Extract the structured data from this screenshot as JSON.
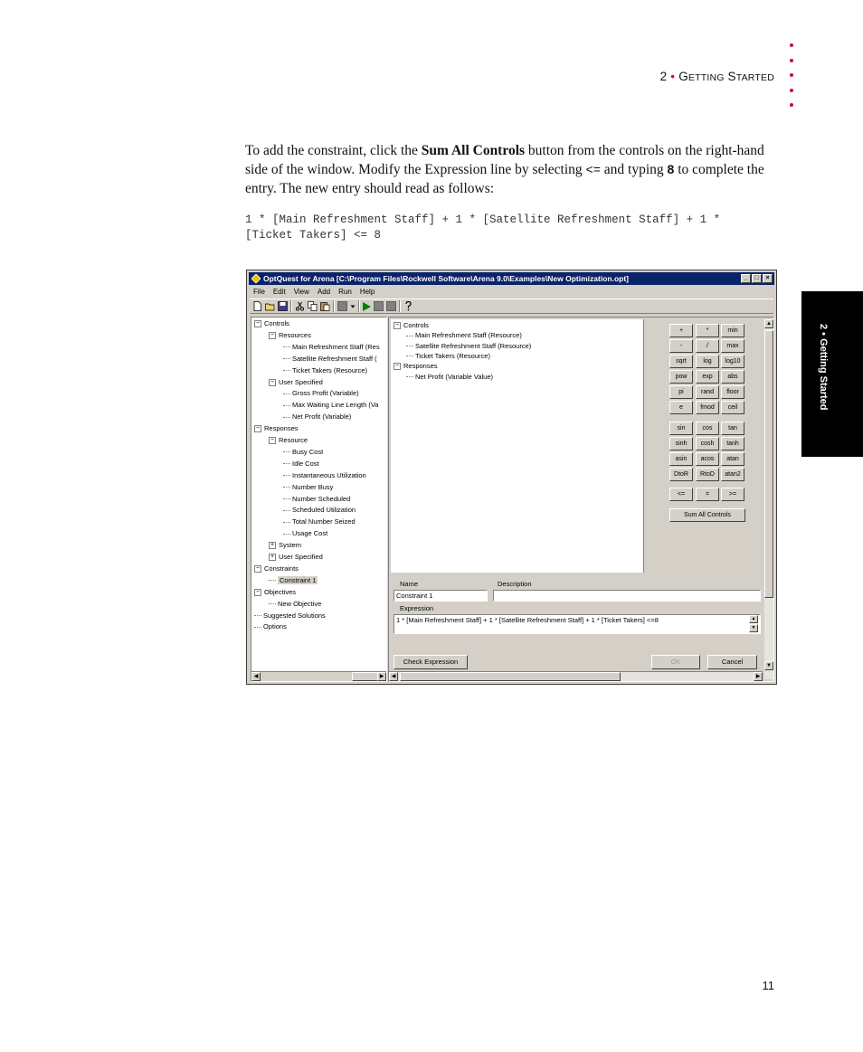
{
  "running_head": {
    "chapter": "2",
    "bullet": "•",
    "title_g": "G",
    "title_rest1": "ETTING",
    "title_s": "S",
    "title_rest2": "TARTED"
  },
  "side_tab": "2 • Getting Started",
  "paragraph": {
    "p1": "To add the constraint, click the ",
    "b1": "Sum All Controls",
    "p2": " button from the controls on the right-hand side of the window. Modify the Expression line by selecting ",
    "s1": "<=",
    "p3": " and typing ",
    "s2": "8",
    "p4": " to complete the entry. The new entry should read as follows:"
  },
  "code_lines": [
    "1 * [Main Refreshment Staff] + 1 * [Satellite Refreshment Staff] + 1 *",
    "[Ticket Takers] <= 8"
  ],
  "window": {
    "title": "OptQuest for Arena  [C:\\Program Files\\Rockwell Software\\Arena 9.0\\Examples\\New Optimization.opt]",
    "menu": [
      "File",
      "Edit",
      "View",
      "Add",
      "Run",
      "Help"
    ],
    "tree": [
      {
        "label": "Controls",
        "indent": 0,
        "pm": "−"
      },
      {
        "label": "Resources",
        "indent": 1,
        "pm": "−"
      },
      {
        "label": "Main Refreshment Staff (Res",
        "indent": 2
      },
      {
        "label": "Satellite Refreshment Staff (",
        "indent": 2
      },
      {
        "label": "Ticket Takers (Resource)",
        "indent": 2
      },
      {
        "label": "User Specified",
        "indent": 1,
        "pm": "−"
      },
      {
        "label": "Gross Profit (Variable)",
        "indent": 2
      },
      {
        "label": "Max Waiting Line Length (Va",
        "indent": 2
      },
      {
        "label": "Net Profit (Variable)",
        "indent": 2
      },
      {
        "label": "Responses",
        "indent": 0,
        "pm": "−"
      },
      {
        "label": "Resource",
        "indent": 1,
        "pm": "−"
      },
      {
        "label": "Busy Cost",
        "indent": 2
      },
      {
        "label": "Idle Cost",
        "indent": 2
      },
      {
        "label": "Instantaneous Utilization",
        "indent": 2
      },
      {
        "label": "Number Busy",
        "indent": 2
      },
      {
        "label": "Number Scheduled",
        "indent": 2
      },
      {
        "label": "Scheduled Utilization",
        "indent": 2
      },
      {
        "label": "Total Number Seized",
        "indent": 2
      },
      {
        "label": "Usage Cost",
        "indent": 2
      },
      {
        "label": "System",
        "indent": 1,
        "pm": "+"
      },
      {
        "label": "User Specified",
        "indent": 1,
        "pm": "+"
      },
      {
        "label": "Constraints",
        "indent": 0,
        "pm": "−"
      },
      {
        "label": "Constraint 1",
        "indent": 1,
        "selected": true
      },
      {
        "label": "Objectives",
        "indent": 0,
        "pm": "−"
      },
      {
        "label": "New Objective",
        "indent": 1
      },
      {
        "label": "Suggested Solutions",
        "indent": 0
      },
      {
        "label": "Options",
        "indent": 0
      }
    ],
    "controls_tree": [
      {
        "label": "Controls",
        "indent": 0,
        "pm": "−"
      },
      {
        "label": "Main Refreshment Staff (Resource)",
        "indent": 1
      },
      {
        "label": "Satellite Refreshment Staff (Resource)",
        "indent": 1
      },
      {
        "label": "Ticket Takers (Resource)",
        "indent": 1
      },
      {
        "label": "Responses",
        "indent": 0,
        "pm": "−"
      },
      {
        "label": "Net Profit (Variable Value)",
        "indent": 1
      }
    ],
    "calc_rows": [
      [
        "+",
        "*",
        "min"
      ],
      [
        "-",
        "/",
        "max"
      ],
      [
        "sqrt",
        "log",
        "log10"
      ],
      [
        "pow",
        "exp",
        "abs"
      ],
      [
        "pi",
        "rand",
        "floor"
      ],
      [
        "e",
        "fmod",
        "ceil"
      ],
      [],
      [
        "sin",
        "cos",
        "tan"
      ],
      [
        "sinh",
        "cosh",
        "tanh"
      ],
      [
        "asin",
        "acos",
        "atan"
      ],
      [
        "DtoR",
        "RtoD",
        "atan2"
      ]
    ],
    "compare_buttons": [
      "<=",
      "=",
      ">="
    ],
    "sum_button": "Sum All Controls",
    "name_label": "Name",
    "description_label": "Description",
    "name_value": "Constraint 1",
    "description_value": "",
    "expression_label": "Expression",
    "expression_value": "1 * [Main Refreshment Staff] + 1 * [Satellite Refreshment Staff] + 1 * [Ticket Takers] <=8",
    "check_button": "Check Expression",
    "ok_button": "OK",
    "cancel_button": "Cancel"
  },
  "page_number": "11",
  "colors": {
    "accent_red": "#c8102e",
    "titlebar": "#0a246a",
    "window_face": "#d4d0c8"
  }
}
